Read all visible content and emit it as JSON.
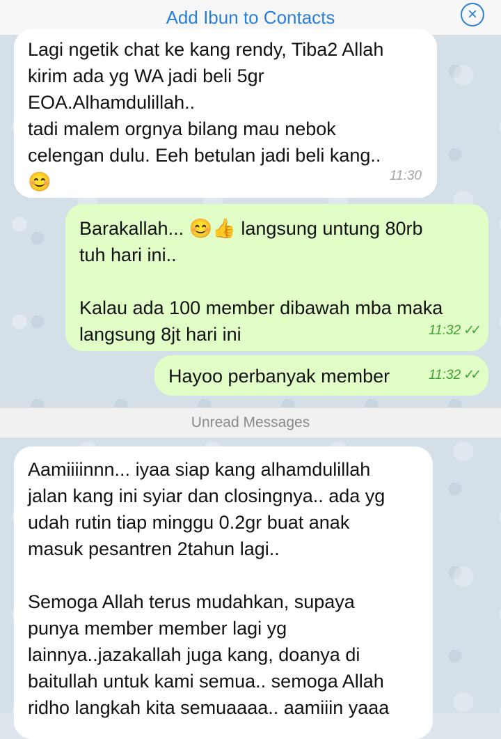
{
  "header": {
    "title": "Add Ibun to Contacts",
    "close_icon": "close-circle-icon"
  },
  "messages": [
    {
      "direction": "incoming",
      "text": "Lagi ngetik chat ke kang rendy, Tiba2 Allah\nkirim ada yg WA jadi beli 5gr\nEOA.Alhamdulillah..\ntadi malem orgnya bilang mau nebok\ncelengan dulu. Eeh betulan jadi beli kang..\n😊",
      "time": "11:30"
    },
    {
      "direction": "outgoing",
      "text": "Barakallah... 😊👍 langsung untung 80rb\ntuh hari ini..\n\nKalau ada 100 member dibawah mba maka\nlangsung 8jt hari ini",
      "time": "11:32",
      "status": "read"
    },
    {
      "direction": "outgoing",
      "text": "Hayoo perbanyak member",
      "time": "11:32",
      "status": "read"
    },
    {
      "direction": "incoming",
      "text": "Aamiiiinnn... iyaa siap kang alhamdulillah\njalan kang ini syiar dan closingnya.. ada yg\nudah rutin tiap minggu 0.2gr buat anak\nmasuk pesantren 2tahun lagi..\n\nSemoga Allah terus mudahkan, supaya\npunya member member lagi yg\nlainnya..jazakallah juga kang, doanya di\nbaitullah untuk kami semua.. semoga Allah\nridho langkah kita semuaaaa.. aamiiin yaaa"
    }
  ],
  "unread_label": "Unread Messages",
  "check_glyph": "✓✓",
  "colors": {
    "accent": "#2a7fd4",
    "outgoing_bubble": "#e1fec6",
    "incoming_bubble": "#ffffff",
    "read_check": "#3fa336"
  }
}
